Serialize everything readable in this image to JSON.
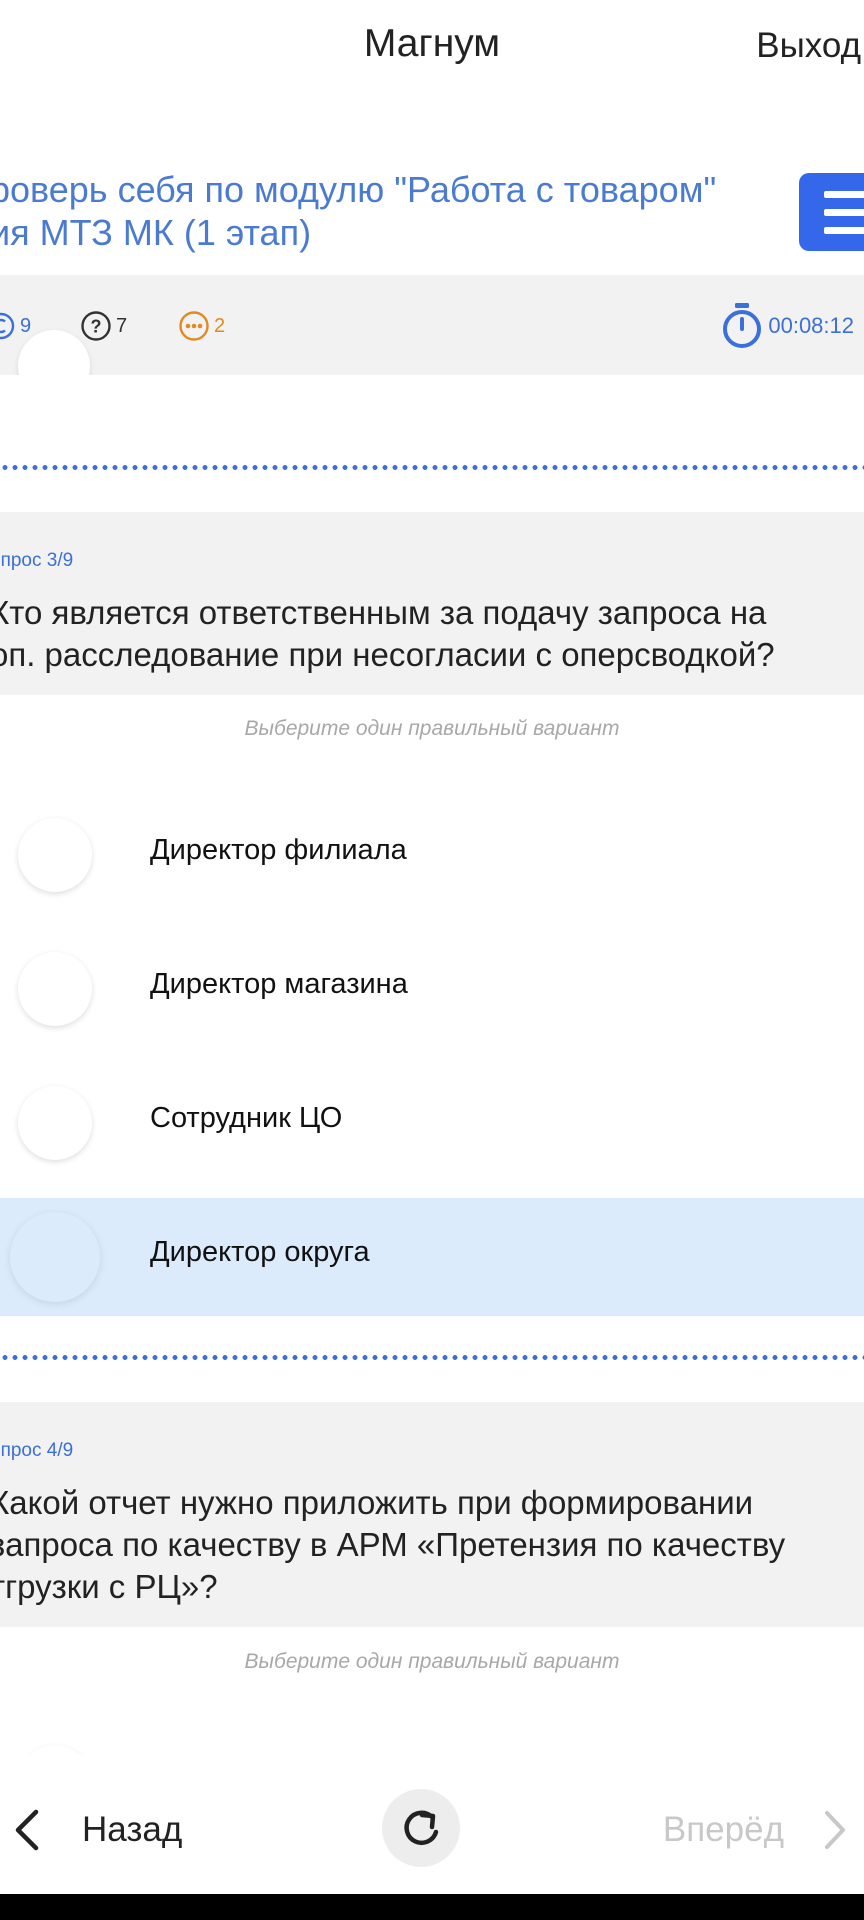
{
  "header": {
    "title": "Магнум",
    "exit_label": "Выход"
  },
  "test": {
    "title_line1": "роверь себя по модулю \"Работа с товаром\"",
    "title_line2": "ия МТЗ МК (1 этап)"
  },
  "stats": {
    "all_count": "9",
    "unanswered_count": "7",
    "skipped_count": "2",
    "timer": "00:08:12"
  },
  "colors": {
    "accent": "#3b6fd9",
    "menu_button": "#3567ea",
    "skipped": "#e08a1f",
    "selected_option_bg": "#dcebfc",
    "section_bg": "#f2f2f2"
  },
  "questions": [
    {
      "number_label": "опрос 3/9",
      "text_line1": "Кто является ответственным за подачу запроса на",
      "text_line2": "оп. расследование при несогласии с оперсводкой?",
      "hint": "Выберите один правильный вариант",
      "options": [
        {
          "label": "Директор филиала",
          "selected": false
        },
        {
          "label": "Директор магазина",
          "selected": false
        },
        {
          "label": "Сотрудник ЦО",
          "selected": false
        },
        {
          "label": "Директор округа",
          "selected": true
        }
      ]
    },
    {
      "number_label": "опрос 4/9",
      "text_line1": "Какой отчет нужно приложить при формировании",
      "text_line2": "запроса по качеству в АРМ «Претензия по качеству",
      "text_line3": "тгрузки с РЦ»?",
      "hint": "Выберите один правильный вариант"
    }
  ],
  "nav": {
    "back_label": "Назад",
    "next_label": "Вперёд"
  }
}
